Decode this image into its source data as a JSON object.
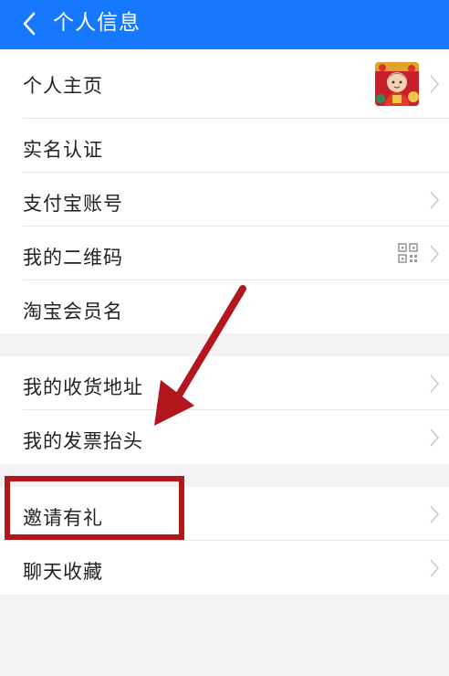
{
  "header": {
    "back_icon": "chevron-left-icon",
    "title": "个人信息"
  },
  "colors": {
    "header_bg": "#1677ff",
    "page_bg": "#f2f2f4",
    "annotation": "#b3161c"
  },
  "groups": [
    {
      "items": [
        {
          "label": "个人主页",
          "trailing": "avatar",
          "chevron": true
        },
        {
          "label": "实名认证",
          "trailing": "",
          "chevron": false
        },
        {
          "label": "支付宝账号",
          "trailing": "",
          "chevron": true
        },
        {
          "label": "我的二维码",
          "trailing": "qr-code-icon",
          "chevron": true
        },
        {
          "label": "淘宝会员名",
          "trailing": "",
          "chevron": false
        }
      ]
    },
    {
      "items": [
        {
          "label": "我的收货地址",
          "trailing": "",
          "chevron": true
        },
        {
          "label": "我的发票抬头",
          "trailing": "",
          "chevron": true
        }
      ]
    },
    {
      "items": [
        {
          "label": "邀请有礼",
          "trailing": "",
          "chevron": true
        },
        {
          "label": "聊天收藏",
          "trailing": "",
          "chevron": true
        }
      ]
    }
  ],
  "annotations": {
    "arrow": "red-arrow-pointing-down-left",
    "highlight": "red-box-around-邀请有礼"
  }
}
